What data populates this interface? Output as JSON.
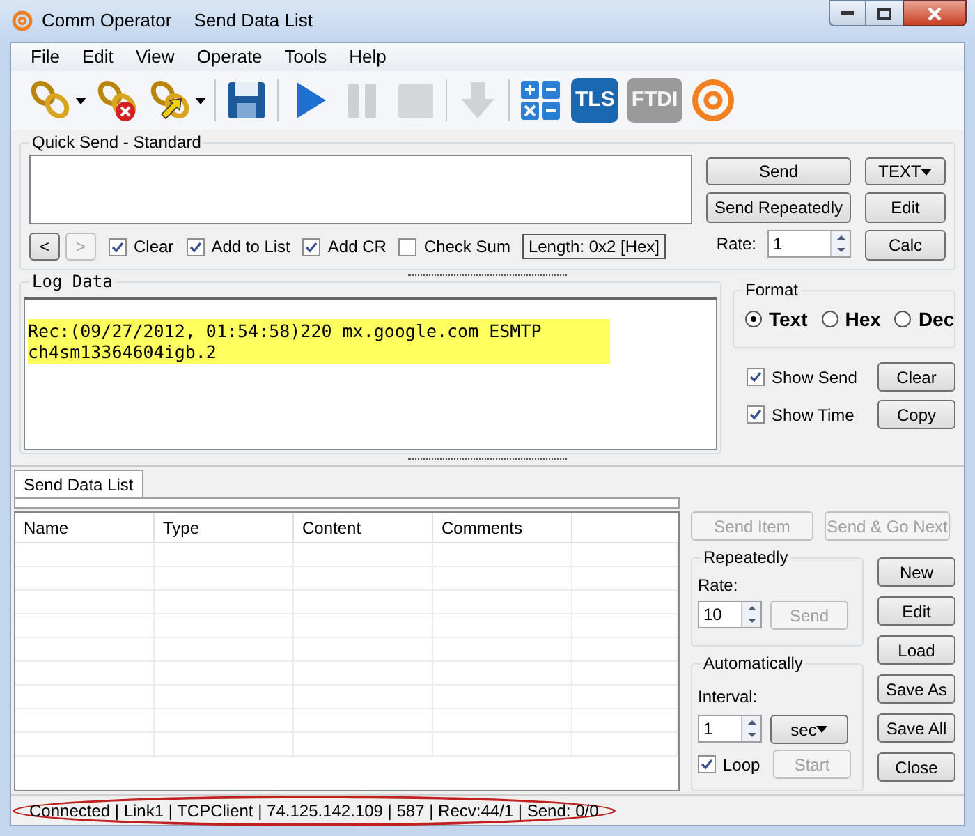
{
  "window": {
    "title": "Comm Operator",
    "document_title": "Send Data List"
  },
  "menu": [
    "File",
    "Edit",
    "View",
    "Operate",
    "Tools",
    "Help"
  ],
  "toolbar": [
    {
      "kind": "connect",
      "dropdown": true,
      "disabled": false
    },
    {
      "kind": "disconnect",
      "dropdown": false,
      "disabled": false
    },
    {
      "kind": "switch",
      "dropdown": true,
      "disabled": false
    },
    {
      "kind": "save",
      "dropdown": false,
      "disabled": false
    },
    {
      "kind": "play",
      "dropdown": false,
      "disabled": false
    },
    {
      "kind": "pause",
      "dropdown": false,
      "disabled": true
    },
    {
      "kind": "stop",
      "dropdown": false,
      "disabled": true
    },
    {
      "kind": "download",
      "dropdown": false,
      "disabled": true
    },
    {
      "kind": "calculator",
      "dropdown": false,
      "disabled": false
    },
    {
      "kind": "badge",
      "label": "TLS",
      "dropdown": false,
      "disabled": false
    },
    {
      "kind": "badge",
      "label": "FTDI",
      "dropdown": false,
      "disabled": true
    },
    {
      "kind": "logo",
      "dropdown": false,
      "disabled": false
    }
  ],
  "quick_send": {
    "title": "Quick Send - Standard",
    "nav": [
      {
        "label": "<",
        "disabled": false
      },
      {
        "label": ">",
        "disabled": true
      }
    ],
    "options": [
      {
        "label": "Clear",
        "checked": true
      },
      {
        "label": "Add to List",
        "checked": true
      },
      {
        "label": "Add CR",
        "checked": true
      },
      {
        "label": "Check Sum",
        "checked": false
      }
    ],
    "length": "Length: 0x2 [Hex]",
    "send": "Send",
    "send_repeatedly": "Send Repeatedly",
    "rate_label": "Rate:",
    "rate": "1",
    "format": "TEXT",
    "edit": "Edit",
    "calc": "Calc"
  },
  "log": {
    "title": "Log Data",
    "lines": [
      "Rec:(09/27/2012, 01:54:58)220 mx.google.com ESMTP",
      "ch4sm13364604igb.2"
    ],
    "format_title": "Format",
    "formats": [
      {
        "label": "Text",
        "selected": true
      },
      {
        "label": "Hex",
        "selected": false
      },
      {
        "label": "Dec",
        "selected": false
      }
    ],
    "options": [
      {
        "label": "Show Send",
        "checked": true
      },
      {
        "label": "Show Time",
        "checked": true
      }
    ],
    "clear": "Clear",
    "copy": "Copy"
  },
  "tabs": [
    {
      "label": "Send Data List",
      "selected": true
    }
  ],
  "table": {
    "columns": [
      "Name",
      "Type",
      "Content",
      "Comments"
    ]
  },
  "list_panel": {
    "send_item": {
      "label": "Send Item",
      "disabled": true
    },
    "send_next": {
      "label": "Send & Go Next",
      "disabled": true
    },
    "repeatedly": {
      "title": "Repeatedly",
      "rate_label": "Rate:",
      "rate": "10",
      "send": {
        "label": "Send",
        "disabled": true
      }
    },
    "automatically": {
      "title": "Automatically",
      "interval_label": "Interval:",
      "interval": "1",
      "unit": "sec",
      "loop": {
        "label": "Loop",
        "checked": true
      },
      "start": {
        "label": "Start",
        "disabled": true
      }
    },
    "buttons": [
      "New",
      "Edit",
      "Load",
      "Save As",
      "Save All",
      "Close"
    ]
  },
  "status_bar": "Connected | Link1 | TCPClient | 74.125.142.109 | 587 | Recv:44/1 | Send: 0/0"
}
